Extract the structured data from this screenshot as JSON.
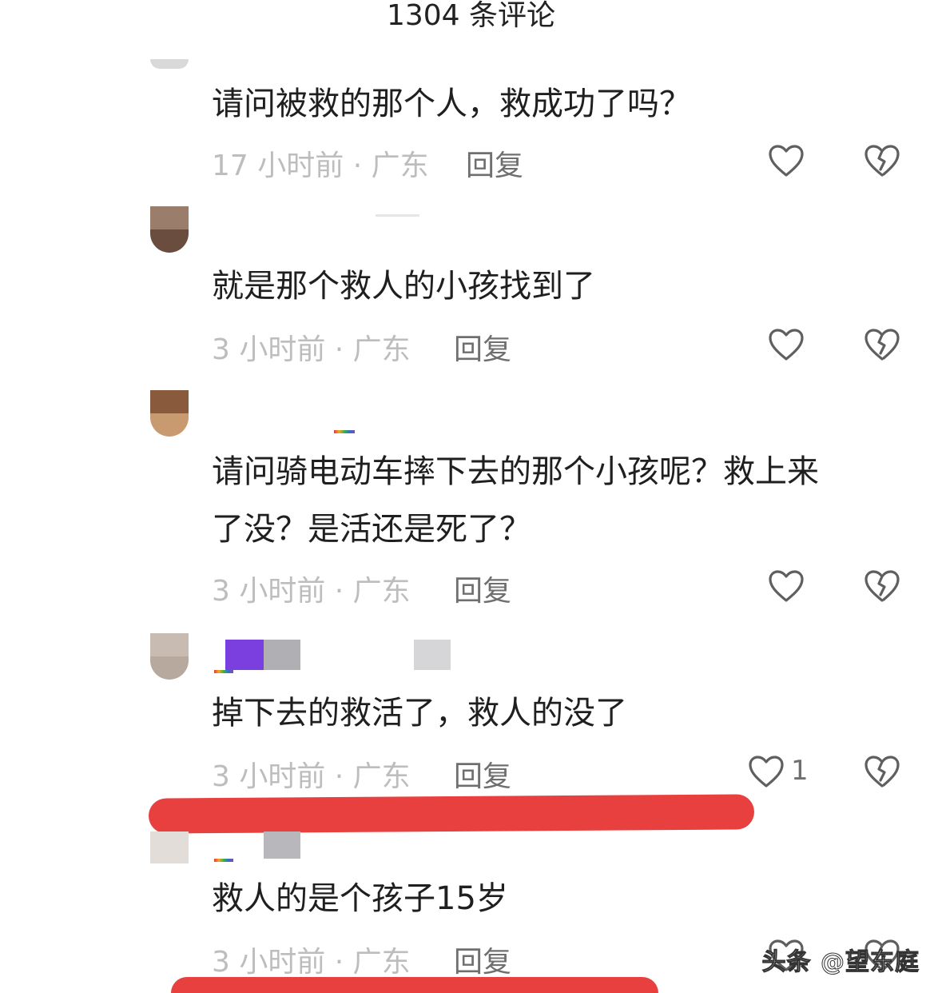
{
  "header": {
    "title": "1304 条评论"
  },
  "comments": [
    {
      "content": "请问被救的那个人，救成功了吗？",
      "time": "17 小时前 · 广东",
      "reply_label": "回复",
      "like_icon": "heart-icon",
      "dislike_icon": "broken-heart-icon"
    },
    {
      "content": "就是那个救人的小孩找到了",
      "time": "3 小时前 · 广东",
      "reply_label": "回复",
      "like_icon": "heart-icon",
      "dislike_icon": "broken-heart-icon"
    },
    {
      "content_line1": "请问骑电动车摔下去的那个小孩呢？救上来",
      "content_line2": "了没？是活还是死了？",
      "time": "3 小时前 · 广东",
      "reply_label": "回复",
      "like_icon": "heart-icon",
      "dislike_icon": "broken-heart-icon"
    },
    {
      "content": "掉下去的救活了，救人的没了",
      "time": "3 小时前 · 广东",
      "reply_label": "回复",
      "like_count": "1",
      "like_icon": "heart-icon",
      "dislike_icon": "broken-heart-icon"
    },
    {
      "content": "救人的是个孩子15岁",
      "time": "3 小时前 · 广东",
      "reply_label": "回复",
      "like_icon": "heart-icon",
      "dislike_icon": "broken-heart-icon"
    }
  ],
  "colors": {
    "highlight": "#e8403f",
    "meta_text": "#bdbdbd",
    "reply_text": "#6f6f6f"
  },
  "watermark": "头条 @望东庭"
}
